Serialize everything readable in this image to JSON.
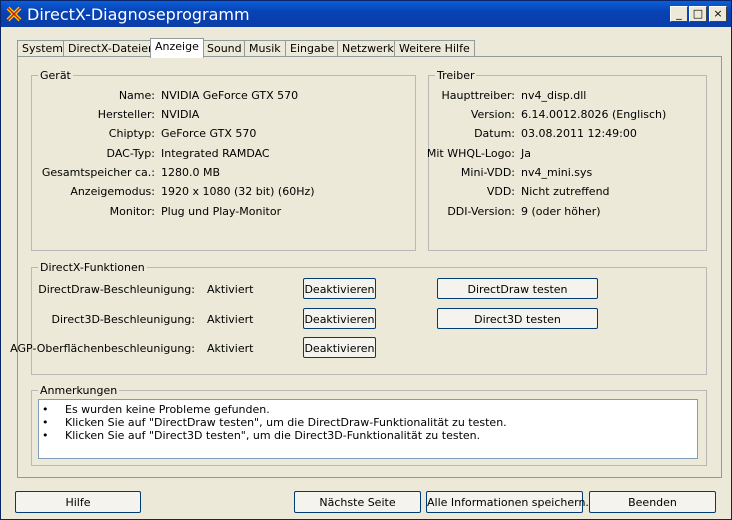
{
  "window": {
    "title": "DirectX-Diagnoseprogramm",
    "minimize": "_",
    "maximize": "□",
    "close": "×"
  },
  "tabs": [
    "System",
    "DirectX-Dateien",
    "Anzeige",
    "Sound",
    "Musik",
    "Eingabe",
    "Netzwerk",
    "Weitere Hilfe"
  ],
  "device": {
    "title": "Gerät",
    "rows": [
      {
        "label": "Name:",
        "value": "NVIDIA GeForce GTX 570"
      },
      {
        "label": "Hersteller:",
        "value": "NVIDIA"
      },
      {
        "label": "Chiptyp:",
        "value": "GeForce GTX 570"
      },
      {
        "label": "DAC-Typ:",
        "value": "Integrated RAMDAC"
      },
      {
        "label": "Gesamtspeicher ca.:",
        "value": "1280.0 MB"
      },
      {
        "label": "Anzeigemodus:",
        "value": "1920 x 1080 (32 bit) (60Hz)"
      },
      {
        "label": "Monitor:",
        "value": "Plug und Play-Monitor"
      }
    ]
  },
  "driver": {
    "title": "Treiber",
    "rows": [
      {
        "label": "Haupttreiber:",
        "value": "nv4_disp.dll"
      },
      {
        "label": "Version:",
        "value": "6.14.0012.8026 (Englisch)"
      },
      {
        "label": "Datum:",
        "value": "03.08.2011 12:49:00"
      },
      {
        "label": "Mit WHQL-Logo:",
        "value": "Ja"
      },
      {
        "label": "Mini-VDD:",
        "value": "nv4_mini.sys"
      },
      {
        "label": "VDD:",
        "value": "Nicht zutreffend"
      },
      {
        "label": "DDI-Version:",
        "value": "9 (oder höher)"
      }
    ]
  },
  "features": {
    "title": "DirectX-Funktionen",
    "rows": [
      {
        "label": "DirectDraw-Beschleunigung:",
        "status": "Aktiviert",
        "button": "Deaktivieren"
      },
      {
        "label": "Direct3D-Beschleunigung:",
        "status": "Aktiviert",
        "button": "Deaktivieren"
      },
      {
        "label": "AGP-Oberflächenbeschleunigung:",
        "status": "Aktiviert",
        "button": "Deaktivieren"
      }
    ],
    "test_directdraw": "DirectDraw testen",
    "test_direct3d": "Direct3D testen"
  },
  "notes": {
    "title": "Anmerkungen",
    "items": [
      "Es wurden keine Probleme gefunden.",
      "Klicken Sie auf \"DirectDraw testen\", um die DirectDraw-Funktionalität zu testen.",
      "Klicken Sie auf \"Direct3D testen\", um die Direct3D-Funktionalität zu testen."
    ],
    "bullet": "•"
  },
  "footer": {
    "help": "Hilfe",
    "next": "Nächste Seite",
    "save": "Alle Informationen speichern...",
    "exit": "Beenden"
  }
}
